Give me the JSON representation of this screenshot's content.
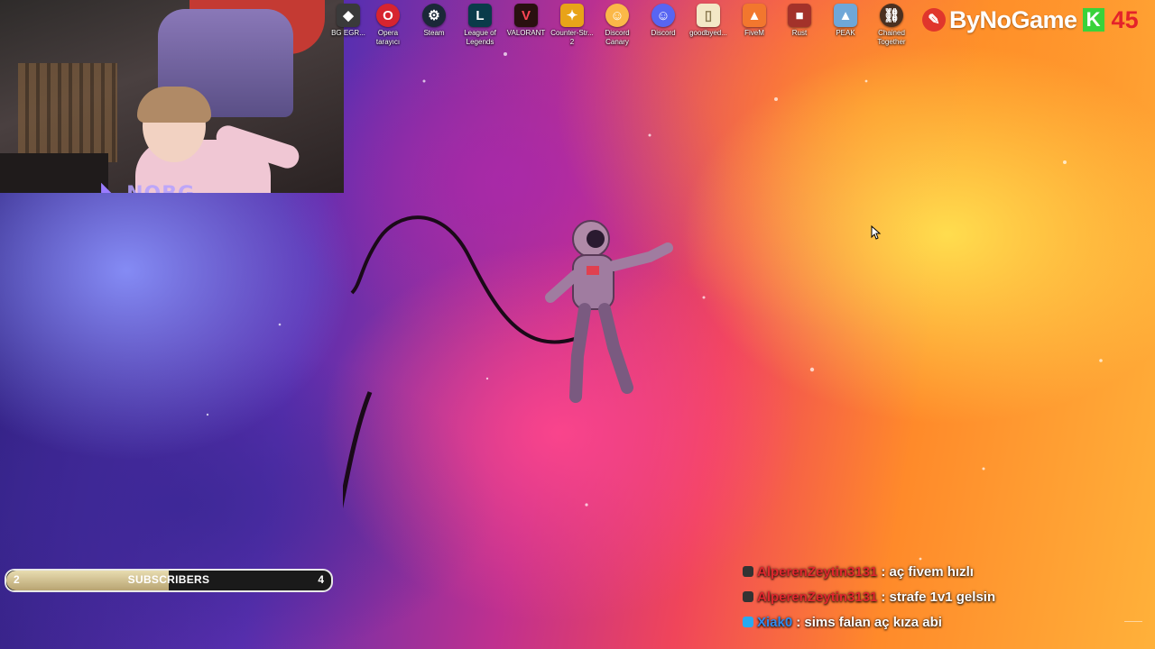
{
  "desktop": {
    "icons": [
      {
        "label": "BG EGR...",
        "icon": "bg-app-icon",
        "color": "#3a3a3a",
        "glyph": "◆"
      },
      {
        "label": "Opera tarayıcı",
        "icon": "opera-icon",
        "color": "#d7242f",
        "glyph": "O"
      },
      {
        "label": "Steam",
        "icon": "steam-icon",
        "color": "#1b2838",
        "glyph": "⚙"
      },
      {
        "label": "League of Legends",
        "icon": "league-icon",
        "color": "#0a3b4a",
        "glyph": "L"
      },
      {
        "label": "VALORANT",
        "icon": "valorant-icon",
        "color": "#2a1010",
        "glyph": "V"
      },
      {
        "label": "Counter-Str... 2",
        "icon": "counter-strike-icon",
        "color": "#e8a318",
        "glyph": "✦"
      },
      {
        "label": "Discord Canary",
        "icon": "discord-canary-icon",
        "color": "#fbb848",
        "glyph": "☺"
      },
      {
        "label": "Discord",
        "icon": "discord-icon",
        "color": "#5865f2",
        "glyph": "☺"
      },
      {
        "label": "goodbyed...",
        "icon": "file-icon",
        "color": "#f3e8c6",
        "glyph": "▯"
      },
      {
        "label": "FiveM",
        "icon": "fivem-icon",
        "color": "#f2772e",
        "glyph": "▲"
      },
      {
        "label": "Rust",
        "icon": "rust-icon",
        "color": "#a3322a",
        "glyph": "■"
      },
      {
        "label": "PEAK",
        "icon": "peak-icon",
        "color": "#6fa7d8",
        "glyph": "▲"
      },
      {
        "label": "Chained Together",
        "icon": "chained-together-icon",
        "color": "#4a3020",
        "glyph": "⛓"
      }
    ]
  },
  "brand": {
    "name": "ByNoGame",
    "k_badge": "K",
    "number": "45",
    "accent": "#e4232a"
  },
  "webcam": {
    "overlay_logo": "NOBG"
  },
  "subscriber_goal": {
    "label": "SUBSCRIBERS",
    "current": "2",
    "goal": "4",
    "progress": 0.5,
    "fill_color": "#d8c98e"
  },
  "chat": {
    "messages": [
      {
        "user": "AlperenZeytin3131",
        "user_color": "#e0262e",
        "text": ": aç fivem hızlı",
        "badge_color": "#333333"
      },
      {
        "user": "AlperenZeytin3131",
        "user_color": "#e0262e",
        "text": ": strafe 1v1 gelsin",
        "badge_color": "#333333"
      },
      {
        "user": "Xiak0",
        "user_color": "#2f8cf0",
        "text": ": sims falan aç kıza abi",
        "badge_color": "#29a9f0"
      }
    ]
  }
}
